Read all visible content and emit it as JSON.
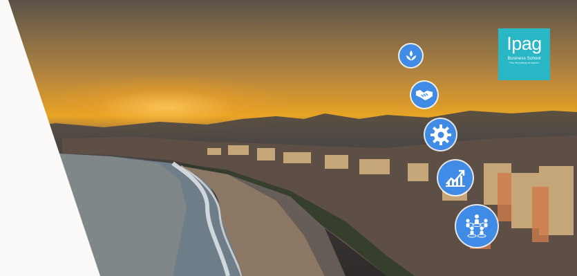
{
  "logo": {
    "brand": "Ipag",
    "subtitle": "Business School",
    "tagline": "Pour the business an inspired",
    "background_color": "#29b6c5"
  },
  "icons": [
    {
      "name": "leaf-icon"
    },
    {
      "name": "handshake-icon"
    },
    {
      "name": "gear-icon"
    },
    {
      "name": "growth-chart-icon"
    },
    {
      "name": "people-network-icon"
    }
  ],
  "colors": {
    "bubble": "#3f8be6",
    "panel": "#fbfaf8"
  }
}
